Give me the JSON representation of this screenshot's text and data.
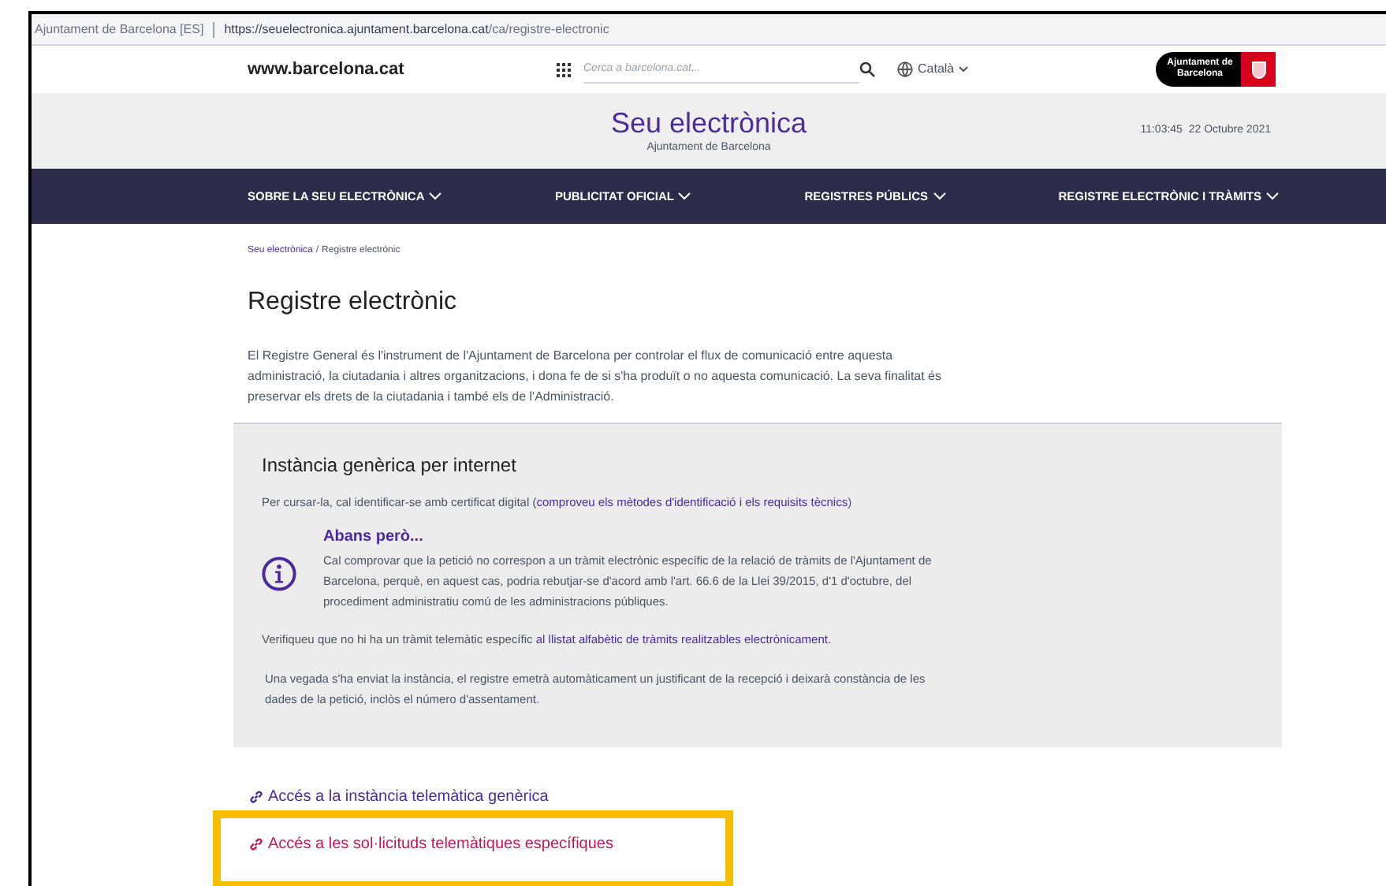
{
  "browser": {
    "site_identity": "Ajuntament de Barcelona [ES]",
    "url_host": "https://seuelectronica.ajuntament.barcelona.cat",
    "url_path": "/ca/registre-electronic"
  },
  "header": {
    "site": "www.barcelona.cat",
    "search": {
      "placeholder": "Cerca a barcelona.cat..."
    },
    "language": "Català",
    "logo_text": "Ajuntament de Barcelona"
  },
  "banner": {
    "title": "Seu electrònica",
    "subtitle": "Ajuntament de Barcelona",
    "time": "11:03:45",
    "date": "22 Octubre 2021"
  },
  "nav": [
    "SOBRE LA SEU ELECTRÒNICA",
    "PUBLICITAT OFICIAL",
    "REGISTRES PÚBLICS",
    "REGISTRE ELECTRÒNIC I TRÀMITS"
  ],
  "breadcrumb_separator": "/",
  "breadcrumb": [
    {
      "label": "Seu electrònica",
      "kind": "link"
    },
    {
      "label": "Registre electrònic",
      "kind": "current"
    }
  ],
  "page_title": "Registre electrònic",
  "intro": "El Registre General és l'instrument de l'Ajuntament de Barcelona per controlar el flux de comunicació entre aquesta administració, la ciutadania i altres organitzacions, i dona fe de si s'ha produït o no aquesta comunicació. La seva finalitat és preservar els drets de la ciutadania i també els de l'Administració.",
  "card": {
    "title": "Instància genèrica per internet",
    "identification": {
      "text": "Per cursar-la, cal identificar-se amb certificat digital (",
      "link": "comproveu els mètodes d'identificació i els requisits tècnics",
      "after": ")"
    },
    "notice": {
      "title": "Abans però...",
      "text": "Cal comprovar que la petició no correspon a un tràmit electrònic específic de la relació de tràmits de l'Ajuntament de Barcelona, perquè, en aquest cas, podria rebutjar-se d'acord amb l'art. 66.6 de la Llei 39/2015, d'1 d'octubre, del procediment administratiu comú de les administracions públiques."
    },
    "verify": {
      "text": "Verifiqueu que no hi ha un tràmit telemàtic específic ",
      "link": "al llistat alfabètic de tràmits realitzables electrònicament."
    },
    "receipt": "Una vegada s'ha enviat la instància, el registre emetrà automàticament un justificant de la recepció i deixarà constància de les dades de la petició, inclòs el número d'assentament."
  },
  "links": [
    {
      "label": "Accés a la instància telemàtica genèrica",
      "highlighted": false
    },
    {
      "label": "Accés a les sol·licituds telemàtiques específiques",
      "highlighted": true
    }
  ]
}
